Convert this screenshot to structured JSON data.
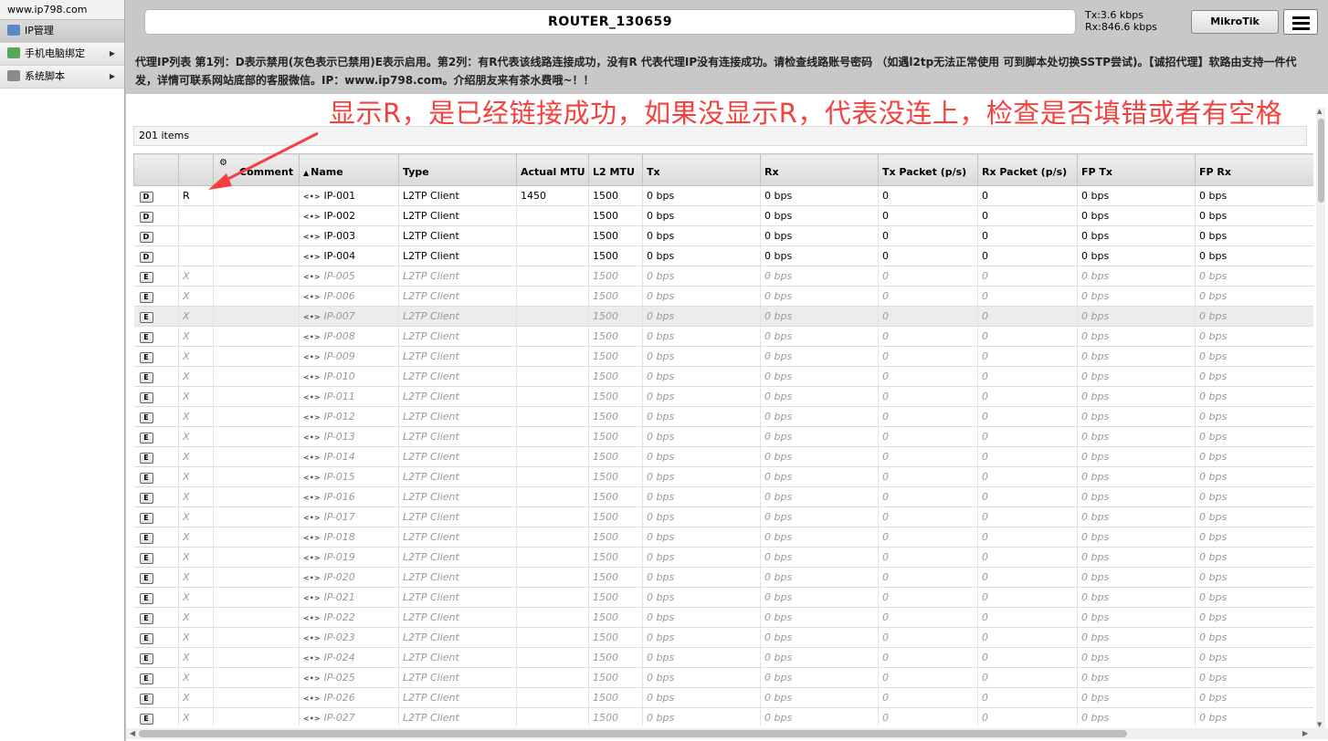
{
  "sidebar": {
    "site_url": "www.ip798.com",
    "items": [
      {
        "label": "IP管理",
        "icon": "ip-list-icon",
        "active": true,
        "has_submenu": false,
        "icon_color": "#5b88c7"
      },
      {
        "label": "手机电脑绑定",
        "icon": "bind-device-icon",
        "active": false,
        "has_submenu": true,
        "icon_color": "#58a55c"
      },
      {
        "label": "系统脚本",
        "icon": "gear-icon",
        "active": false,
        "has_submenu": true,
        "icon_color": "#8a8a8a"
      }
    ],
    "submenu_arrow": "▶"
  },
  "header": {
    "router_name": "ROUTER_130659",
    "tx": "Tx:3.6 kbps",
    "rx": "Rx:846.6 kbps",
    "brand_button": "MikroTik"
  },
  "notice": "代理IP列表 第1列：D表示禁用(灰色表示已禁用)E表示启用。第2列：有R代表该线路连接成功，没有R 代表代理IP没有连接成功。请检查线路账号密码 （如遇l2tp无法正常使用 可到脚本处切换SSTP尝试)。【诚招代理】软路由支持一件代发，详情可联系网站底部的客服微信。IP：www.ip798.com。介绍朋友来有茶水费哦~！！",
  "annotation": {
    "text": "显示R，是已经链接成功，如果没显示R，代表没连上，检查是否填错或者有空格",
    "color": "#f3423e"
  },
  "table": {
    "item_count": "201 items",
    "sort_indicator": "▲",
    "columns": [
      "",
      "",
      "Comment",
      "Name",
      "Type",
      "Actual MTU",
      "L2 MTU",
      "Tx",
      "Rx",
      "Tx Packet (p/s)",
      "Rx Packet (p/s)",
      "FP Tx",
      "FP Rx"
    ],
    "rows": [
      {
        "flag": "D",
        "status": "R",
        "comment": "",
        "name": "IP-001",
        "type": "L2TP Client",
        "actual_mtu": "1450",
        "l2_mtu": "1500",
        "tx": "0 bps",
        "rx": "0 bps",
        "tx_packet": "0",
        "rx_packet": "0",
        "fp_tx": "0 bps",
        "fp_rx": "0 bps",
        "disabled": false
      },
      {
        "flag": "D",
        "status": "",
        "comment": "",
        "name": "IP-002",
        "type": "L2TP Client",
        "actual_mtu": "",
        "l2_mtu": "1500",
        "tx": "0 bps",
        "rx": "0 bps",
        "tx_packet": "0",
        "rx_packet": "0",
        "fp_tx": "0 bps",
        "fp_rx": "0 bps",
        "disabled": false
      },
      {
        "flag": "D",
        "status": "",
        "comment": "",
        "name": "IP-003",
        "type": "L2TP Client",
        "actual_mtu": "",
        "l2_mtu": "1500",
        "tx": "0 bps",
        "rx": "0 bps",
        "tx_packet": "0",
        "rx_packet": "0",
        "fp_tx": "0 bps",
        "fp_rx": "0 bps",
        "disabled": false
      },
      {
        "flag": "D",
        "status": "",
        "comment": "",
        "name": "IP-004",
        "type": "L2TP Client",
        "actual_mtu": "",
        "l2_mtu": "1500",
        "tx": "0 bps",
        "rx": "0 bps",
        "tx_packet": "0",
        "rx_packet": "0",
        "fp_tx": "0 bps",
        "fp_rx": "0 bps",
        "disabled": false
      },
      {
        "flag": "E",
        "status": "X",
        "comment": "",
        "name": "IP-005",
        "type": "L2TP Client",
        "actual_mtu": "",
        "l2_mtu": "1500",
        "tx": "0 bps",
        "rx": "0 bps",
        "tx_packet": "0",
        "rx_packet": "0",
        "fp_tx": "0 bps",
        "fp_rx": "0 bps",
        "disabled": true
      },
      {
        "flag": "E",
        "status": "X",
        "comment": "",
        "name": "IP-006",
        "type": "L2TP Client",
        "actual_mtu": "",
        "l2_mtu": "1500",
        "tx": "0 bps",
        "rx": "0 bps",
        "tx_packet": "0",
        "rx_packet": "0",
        "fp_tx": "0 bps",
        "fp_rx": "0 bps",
        "disabled": true
      },
      {
        "flag": "E",
        "status": "X",
        "comment": "",
        "name": "IP-007",
        "type": "L2TP Client",
        "actual_mtu": "",
        "l2_mtu": "1500",
        "tx": "0 bps",
        "rx": "0 bps",
        "tx_packet": "0",
        "rx_packet": "0",
        "fp_tx": "0 bps",
        "fp_rx": "0 bps",
        "disabled": true,
        "selected": true
      },
      {
        "flag": "E",
        "status": "X",
        "comment": "",
        "name": "IP-008",
        "type": "L2TP Client",
        "actual_mtu": "",
        "l2_mtu": "1500",
        "tx": "0 bps",
        "rx": "0 bps",
        "tx_packet": "0",
        "rx_packet": "0",
        "fp_tx": "0 bps",
        "fp_rx": "0 bps",
        "disabled": true
      },
      {
        "flag": "E",
        "status": "X",
        "comment": "",
        "name": "IP-009",
        "type": "L2TP Client",
        "actual_mtu": "",
        "l2_mtu": "1500",
        "tx": "0 bps",
        "rx": "0 bps",
        "tx_packet": "0",
        "rx_packet": "0",
        "fp_tx": "0 bps",
        "fp_rx": "0 bps",
        "disabled": true
      },
      {
        "flag": "E",
        "status": "X",
        "comment": "",
        "name": "IP-010",
        "type": "L2TP Client",
        "actual_mtu": "",
        "l2_mtu": "1500",
        "tx": "0 bps",
        "rx": "0 bps",
        "tx_packet": "0",
        "rx_packet": "0",
        "fp_tx": "0 bps",
        "fp_rx": "0 bps",
        "disabled": true
      },
      {
        "flag": "E",
        "status": "X",
        "comment": "",
        "name": "IP-011",
        "type": "L2TP Client",
        "actual_mtu": "",
        "l2_mtu": "1500",
        "tx": "0 bps",
        "rx": "0 bps",
        "tx_packet": "0",
        "rx_packet": "0",
        "fp_tx": "0 bps",
        "fp_rx": "0 bps",
        "disabled": true
      },
      {
        "flag": "E",
        "status": "X",
        "comment": "",
        "name": "IP-012",
        "type": "L2TP Client",
        "actual_mtu": "",
        "l2_mtu": "1500",
        "tx": "0 bps",
        "rx": "0 bps",
        "tx_packet": "0",
        "rx_packet": "0",
        "fp_tx": "0 bps",
        "fp_rx": "0 bps",
        "disabled": true
      },
      {
        "flag": "E",
        "status": "X",
        "comment": "",
        "name": "IP-013",
        "type": "L2TP Client",
        "actual_mtu": "",
        "l2_mtu": "1500",
        "tx": "0 bps",
        "rx": "0 bps",
        "tx_packet": "0",
        "rx_packet": "0",
        "fp_tx": "0 bps",
        "fp_rx": "0 bps",
        "disabled": true
      },
      {
        "flag": "E",
        "status": "X",
        "comment": "",
        "name": "IP-014",
        "type": "L2TP Client",
        "actual_mtu": "",
        "l2_mtu": "1500",
        "tx": "0 bps",
        "rx": "0 bps",
        "tx_packet": "0",
        "rx_packet": "0",
        "fp_tx": "0 bps",
        "fp_rx": "0 bps",
        "disabled": true
      },
      {
        "flag": "E",
        "status": "X",
        "comment": "",
        "name": "IP-015",
        "type": "L2TP Client",
        "actual_mtu": "",
        "l2_mtu": "1500",
        "tx": "0 bps",
        "rx": "0 bps",
        "tx_packet": "0",
        "rx_packet": "0",
        "fp_tx": "0 bps",
        "fp_rx": "0 bps",
        "disabled": true
      },
      {
        "flag": "E",
        "status": "X",
        "comment": "",
        "name": "IP-016",
        "type": "L2TP Client",
        "actual_mtu": "",
        "l2_mtu": "1500",
        "tx": "0 bps",
        "rx": "0 bps",
        "tx_packet": "0",
        "rx_packet": "0",
        "fp_tx": "0 bps",
        "fp_rx": "0 bps",
        "disabled": true
      },
      {
        "flag": "E",
        "status": "X",
        "comment": "",
        "name": "IP-017",
        "type": "L2TP Client",
        "actual_mtu": "",
        "l2_mtu": "1500",
        "tx": "0 bps",
        "rx": "0 bps",
        "tx_packet": "0",
        "rx_packet": "0",
        "fp_tx": "0 bps",
        "fp_rx": "0 bps",
        "disabled": true
      },
      {
        "flag": "E",
        "status": "X",
        "comment": "",
        "name": "IP-018",
        "type": "L2TP Client",
        "actual_mtu": "",
        "l2_mtu": "1500",
        "tx": "0 bps",
        "rx": "0 bps",
        "tx_packet": "0",
        "rx_packet": "0",
        "fp_tx": "0 bps",
        "fp_rx": "0 bps",
        "disabled": true
      },
      {
        "flag": "E",
        "status": "X",
        "comment": "",
        "name": "IP-019",
        "type": "L2TP Client",
        "actual_mtu": "",
        "l2_mtu": "1500",
        "tx": "0 bps",
        "rx": "0 bps",
        "tx_packet": "0",
        "rx_packet": "0",
        "fp_tx": "0 bps",
        "fp_rx": "0 bps",
        "disabled": true
      },
      {
        "flag": "E",
        "status": "X",
        "comment": "",
        "name": "IP-020",
        "type": "L2TP Client",
        "actual_mtu": "",
        "l2_mtu": "1500",
        "tx": "0 bps",
        "rx": "0 bps",
        "tx_packet": "0",
        "rx_packet": "0",
        "fp_tx": "0 bps",
        "fp_rx": "0 bps",
        "disabled": true
      },
      {
        "flag": "E",
        "status": "X",
        "comment": "",
        "name": "IP-021",
        "type": "L2TP Client",
        "actual_mtu": "",
        "l2_mtu": "1500",
        "tx": "0 bps",
        "rx": "0 bps",
        "tx_packet": "0",
        "rx_packet": "0",
        "fp_tx": "0 bps",
        "fp_rx": "0 bps",
        "disabled": true
      },
      {
        "flag": "E",
        "status": "X",
        "comment": "",
        "name": "IP-022",
        "type": "L2TP Client",
        "actual_mtu": "",
        "l2_mtu": "1500",
        "tx": "0 bps",
        "rx": "0 bps",
        "tx_packet": "0",
        "rx_packet": "0",
        "fp_tx": "0 bps",
        "fp_rx": "0 bps",
        "disabled": true
      },
      {
        "flag": "E",
        "status": "X",
        "comment": "",
        "name": "IP-023",
        "type": "L2TP Client",
        "actual_mtu": "",
        "l2_mtu": "1500",
        "tx": "0 bps",
        "rx": "0 bps",
        "tx_packet": "0",
        "rx_packet": "0",
        "fp_tx": "0 bps",
        "fp_rx": "0 bps",
        "disabled": true
      },
      {
        "flag": "E",
        "status": "X",
        "comment": "",
        "name": "IP-024",
        "type": "L2TP Client",
        "actual_mtu": "",
        "l2_mtu": "1500",
        "tx": "0 bps",
        "rx": "0 bps",
        "tx_packet": "0",
        "rx_packet": "0",
        "fp_tx": "0 bps",
        "fp_rx": "0 bps",
        "disabled": true
      },
      {
        "flag": "E",
        "status": "X",
        "comment": "",
        "name": "IP-025",
        "type": "L2TP Client",
        "actual_mtu": "",
        "l2_mtu": "1500",
        "tx": "0 bps",
        "rx": "0 bps",
        "tx_packet": "0",
        "rx_packet": "0",
        "fp_tx": "0 bps",
        "fp_rx": "0 bps",
        "disabled": true
      },
      {
        "flag": "E",
        "status": "X",
        "comment": "",
        "name": "IP-026",
        "type": "L2TP Client",
        "actual_mtu": "",
        "l2_mtu": "1500",
        "tx": "0 bps",
        "rx": "0 bps",
        "tx_packet": "0",
        "rx_packet": "0",
        "fp_tx": "0 bps",
        "fp_rx": "0 bps",
        "disabled": true
      },
      {
        "flag": "E",
        "status": "X",
        "comment": "",
        "name": "IP-027",
        "type": "L2TP Client",
        "actual_mtu": "",
        "l2_mtu": "1500",
        "tx": "0 bps",
        "rx": "0 bps",
        "tx_packet": "0",
        "rx_packet": "0",
        "fp_tx": "0 bps",
        "fp_rx": "0 bps",
        "disabled": true
      }
    ]
  }
}
